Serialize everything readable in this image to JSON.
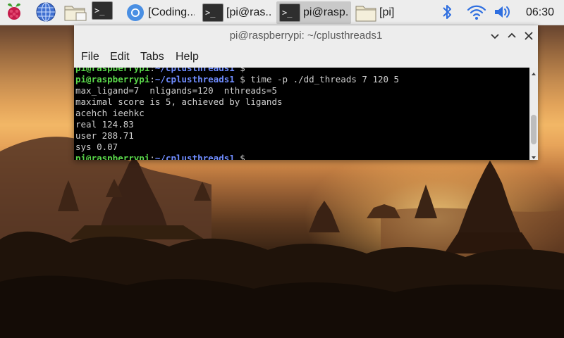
{
  "desktop": {
    "wallpaper": "sunset over temples"
  },
  "taskbar": {
    "launchers": [
      {
        "name": "raspberry-menu-icon"
      },
      {
        "name": "web-browser-icon"
      },
      {
        "name": "file-manager-icon"
      },
      {
        "name": "terminal-icon"
      }
    ],
    "tasks": [
      {
        "label": "[Coding...",
        "icon": "chromium-icon",
        "active": false
      },
      {
        "label": "[pi@ras...",
        "icon": "terminal-icon",
        "active": false
      },
      {
        "label": "pi@rasp...",
        "icon": "terminal-icon",
        "active": true
      },
      {
        "label": "[pi]",
        "icon": "folder-icon",
        "active": false
      }
    ],
    "tray": {
      "bluetooth": "bluetooth-icon",
      "wifi": "wifi-icon",
      "volume": "volume-icon"
    },
    "clock": "06:30"
  },
  "terminal": {
    "title": "pi@raspberrypi: ~/cplusthreads1",
    "menu": [
      "File",
      "Edit",
      "Tabs",
      "Help"
    ],
    "lines": [
      {
        "type": "prompt",
        "user": "pi@raspberrypi",
        "sep": ":",
        "path": "~/cplusthreads1",
        "end": " $",
        "cmd": ""
      },
      {
        "type": "prompt",
        "user": "pi@raspberrypi",
        "sep": ":",
        "path": "~/cplusthreads1",
        "end": " $",
        "cmd": " time -p ./dd_threads 7 120 5"
      },
      {
        "type": "output",
        "text": "max_ligand=7  nligands=120  nthreads=5"
      },
      {
        "type": "output",
        "text": "maximal score is 5, achieved by ligands"
      },
      {
        "type": "output",
        "text": "acehch ieehkc"
      },
      {
        "type": "output",
        "text": "real 124.83"
      },
      {
        "type": "output",
        "text": "user 288.71"
      },
      {
        "type": "output",
        "text": "sys 0.07"
      },
      {
        "type": "prompt",
        "user": "pi@raspberrypi",
        "sep": ":",
        "path": "~/cplusthreads1",
        "end": " $",
        "cmd": ""
      }
    ]
  },
  "colors": {
    "prompt_user": "#5ad84a",
    "prompt_path": "#6f8cff",
    "terminal_bg": "#000000",
    "terminal_fg": "#cfcfcf",
    "taskbar_bg": "#ededed"
  }
}
